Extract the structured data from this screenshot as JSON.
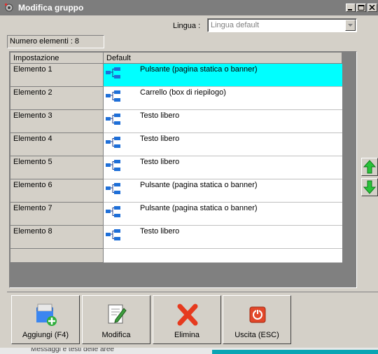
{
  "window": {
    "title": "Modifica gruppo",
    "icon": "app-gear-icon"
  },
  "language": {
    "label": "Lingua :",
    "value": "Lingua default"
  },
  "count": {
    "text": "Numero elementi : 8"
  },
  "grid": {
    "headers": [
      "Impostazione",
      "Default"
    ],
    "rows": [
      {
        "name": "Elemento 1",
        "value": "Pulsante (pagina statica o banner)",
        "selected": true
      },
      {
        "name": "Elemento 2",
        "value": "Carrello (box di riepilogo)",
        "selected": false
      },
      {
        "name": "Elemento 3",
        "value": "Testo libero",
        "selected": false
      },
      {
        "name": "Elemento 4",
        "value": "Testo libero",
        "selected": false
      },
      {
        "name": "Elemento 5",
        "value": "Testo libero",
        "selected": false
      },
      {
        "name": "Elemento 6",
        "value": "Pulsante (pagina statica o banner)",
        "selected": false
      },
      {
        "name": "Elemento 7",
        "value": "Pulsante (pagina statica o banner)",
        "selected": false
      },
      {
        "name": "Elemento 8",
        "value": "Testo libero",
        "selected": false
      }
    ],
    "selection_color": "#00ffff"
  },
  "toolbar": {
    "buttons": [
      {
        "label": "Aggiungi (F4)",
        "icon": "add-folder-icon"
      },
      {
        "label": "Modifica",
        "icon": "edit-document-icon"
      },
      {
        "label": "Elimina",
        "icon": "delete-x-icon"
      },
      {
        "label": "Uscita (ESC)",
        "icon": "power-exit-icon"
      }
    ]
  },
  "taskbar": {
    "text": "Messaggi e testi delle aree"
  }
}
